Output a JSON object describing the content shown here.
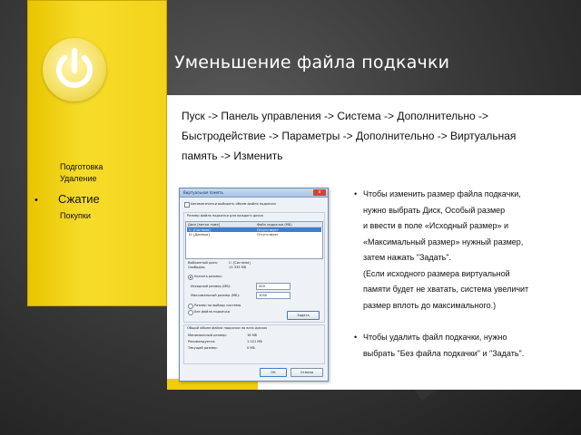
{
  "slide": {
    "title": "Уменьшение файла подкачки",
    "path_line1": "Пуск -> Панель управления -> Система -> Дополнительно ->",
    "path_line2": "Быстродействие -> Параметры -> Дополнительно -> Виртуальная",
    "path_line3": "память -> Изменить"
  },
  "sidebar": {
    "items": [
      "Подготовка",
      "Удаление"
    ],
    "current": "Сжатие",
    "after": "Покупки"
  },
  "bullets": {
    "first": [
      "Чтобы изменить размер файла подкачки,",
      "нужно выбрать Диск, Особый размер",
      "и ввести в поле «Исходный размер» и",
      "«Максимальный размер» нужный размер,",
      "затем нажать \"Задать\".",
      "(Если исходного размера виртуальной",
      "памяти будет не хватать, система увеличит",
      "размер вплоть до максимального.)"
    ],
    "second": [
      "Чтобы удалить файл подкачки, нужно",
      "выбрать \"Без файла подкачки\" и \"Задать\"."
    ]
  },
  "dialog": {
    "title": "Виртуальная память",
    "auto_label": "Автоматически выбирать объем файла подкачки",
    "group_label": "Размер файла подкачки для каждого диска",
    "col_disk": "Диск [метка тома]",
    "col_size": "Файл подкачки (МБ)",
    "row1_disk": "C:  [Система]",
    "row1_size": "Отсутствует",
    "row2_disk": "D:  [Данные]",
    "row2_size": "Отсутствует",
    "selected_disk_label": "Выбранный диск:",
    "selected_disk_value": "C:  [Система]",
    "free_label": "Свободно:",
    "free_value": "13 333 МБ",
    "radio_custom": "Указать размер:",
    "initial_label": "Исходный размер (МБ):",
    "initial_value": "500",
    "max_label": "Максимальный размер (МБ):",
    "max_value": "1000",
    "radio_system": "Размер по выбору системы",
    "radio_none": "Без файла подкачки",
    "set_button": "Задать",
    "total_label": "Общий объем файла подкачки на всех дисках",
    "min_label": "Минимальный размер:",
    "min_value": "16 МБ",
    "rec_label": "Рекомендуется:",
    "rec_value": "1 021 МБ",
    "cur_label": "Текущий размер:",
    "cur_value": "0 МБ",
    "ok_button": "ОК",
    "cancel_button": "Отмена",
    "close_glyph": "x"
  }
}
